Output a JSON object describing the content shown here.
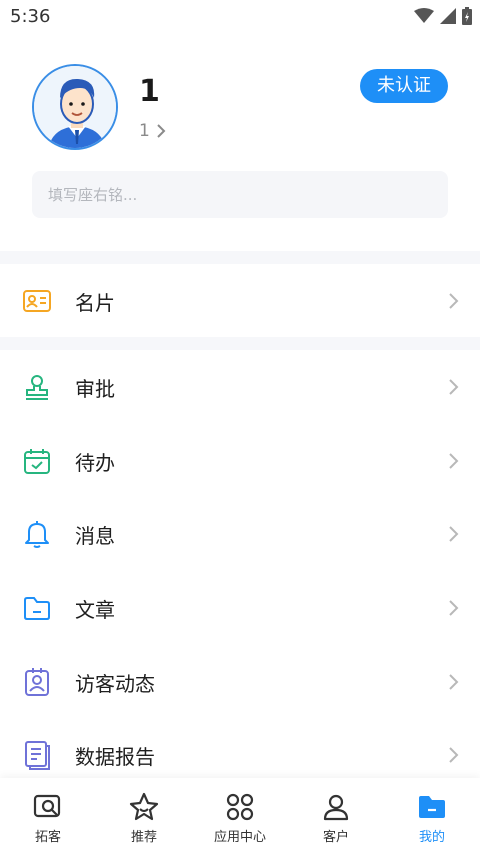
{
  "status_bar": {
    "time": "5:36"
  },
  "profile": {
    "name": "1",
    "sub_text": "1",
    "verify_badge": "未认证",
    "motto_placeholder": "填写座右铭..."
  },
  "menu": [
    {
      "label": "名片",
      "icon": "business-card-icon",
      "color": "#f5a623"
    },
    {
      "label": "审批",
      "icon": "stamp-icon",
      "color": "#26b57f"
    },
    {
      "label": "待办",
      "icon": "calendar-check-icon",
      "color": "#26b57f"
    },
    {
      "label": "消息",
      "icon": "bell-icon",
      "color": "#1e8ff7"
    },
    {
      "label": "文章",
      "icon": "folder-icon",
      "color": "#1e8ff7"
    },
    {
      "label": "访客动态",
      "icon": "visitor-badge-icon",
      "color": "#6f72d8"
    },
    {
      "label": "数据报告",
      "icon": "report-icon",
      "color": "#6f72d8"
    }
  ],
  "tabs": [
    {
      "label": "拓客",
      "icon": "search-card-icon"
    },
    {
      "label": "推荐",
      "icon": "star-icon"
    },
    {
      "label": "应用中心",
      "icon": "apps-grid-icon"
    },
    {
      "label": "客户",
      "icon": "person-icon"
    },
    {
      "label": "我的",
      "icon": "folder-filled-icon"
    }
  ],
  "colors": {
    "accent": "#1e8ff7",
    "text": "#1f1f1f",
    "divider": "#f6f7fa"
  }
}
